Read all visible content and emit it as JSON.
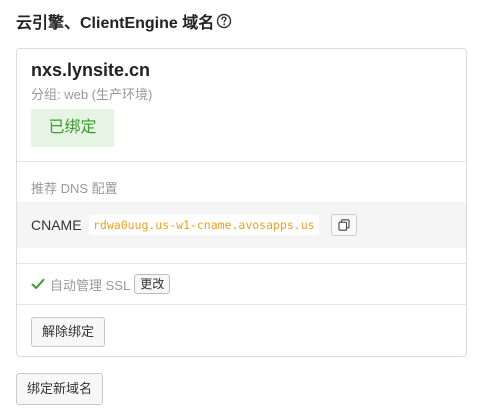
{
  "section": {
    "title": "云引擎、ClientEngine 域名",
    "help_icon": "question-circle-icon"
  },
  "domain_card": {
    "domain": "nxs.lynsite.cn",
    "group_line": "分组: web (生产环境)",
    "status": "已绑定",
    "status_color": "#3c9a2e",
    "dns_label": "推荐 DNS 配置",
    "record_type": "CNAME",
    "record_value": "rdwa0uug.us-w1-cname.avosapps.us",
    "record_value_color": "#f0a020",
    "copy_icon": "copy-icon",
    "ssl_label": "自动管理 SSL",
    "ssl_icon": "check-icon",
    "ssl_icon_color": "#3c9a2e",
    "change_label": "更改",
    "unbind_label": "解除绑定"
  },
  "bind_new_label": "绑定新域名"
}
